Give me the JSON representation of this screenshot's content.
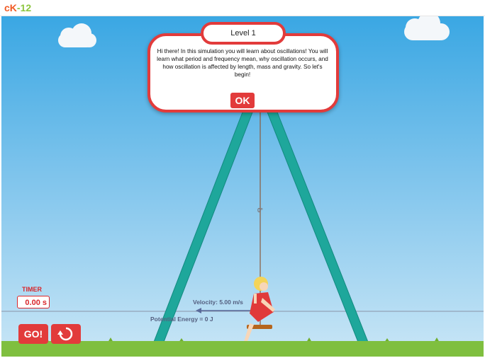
{
  "logo": {
    "ck": "cK",
    "rest": "-12"
  },
  "dialog": {
    "title": "Level 1",
    "text": "Hi there! In this simulation you will learn about oscillations! You will learn what period and frequency mean, why oscillation occurs, and how oscillation is affected by length, mass and gravity. So let's begin!",
    "ok_label": "OK"
  },
  "readouts": {
    "angle": "0°",
    "velocity": "Velocity: 5.00 m/s",
    "potential_energy": "Potential Energy = 0 J"
  },
  "timer": {
    "label": "TIMER",
    "value": "0.00 s"
  },
  "controls": {
    "go_label": "GO!",
    "reset_icon": "reset-icon"
  },
  "colors": {
    "accent": "#e23b3b",
    "frame": "#1ea79b",
    "sky": "#3aa7e3",
    "grass": "#7fbf3f"
  }
}
